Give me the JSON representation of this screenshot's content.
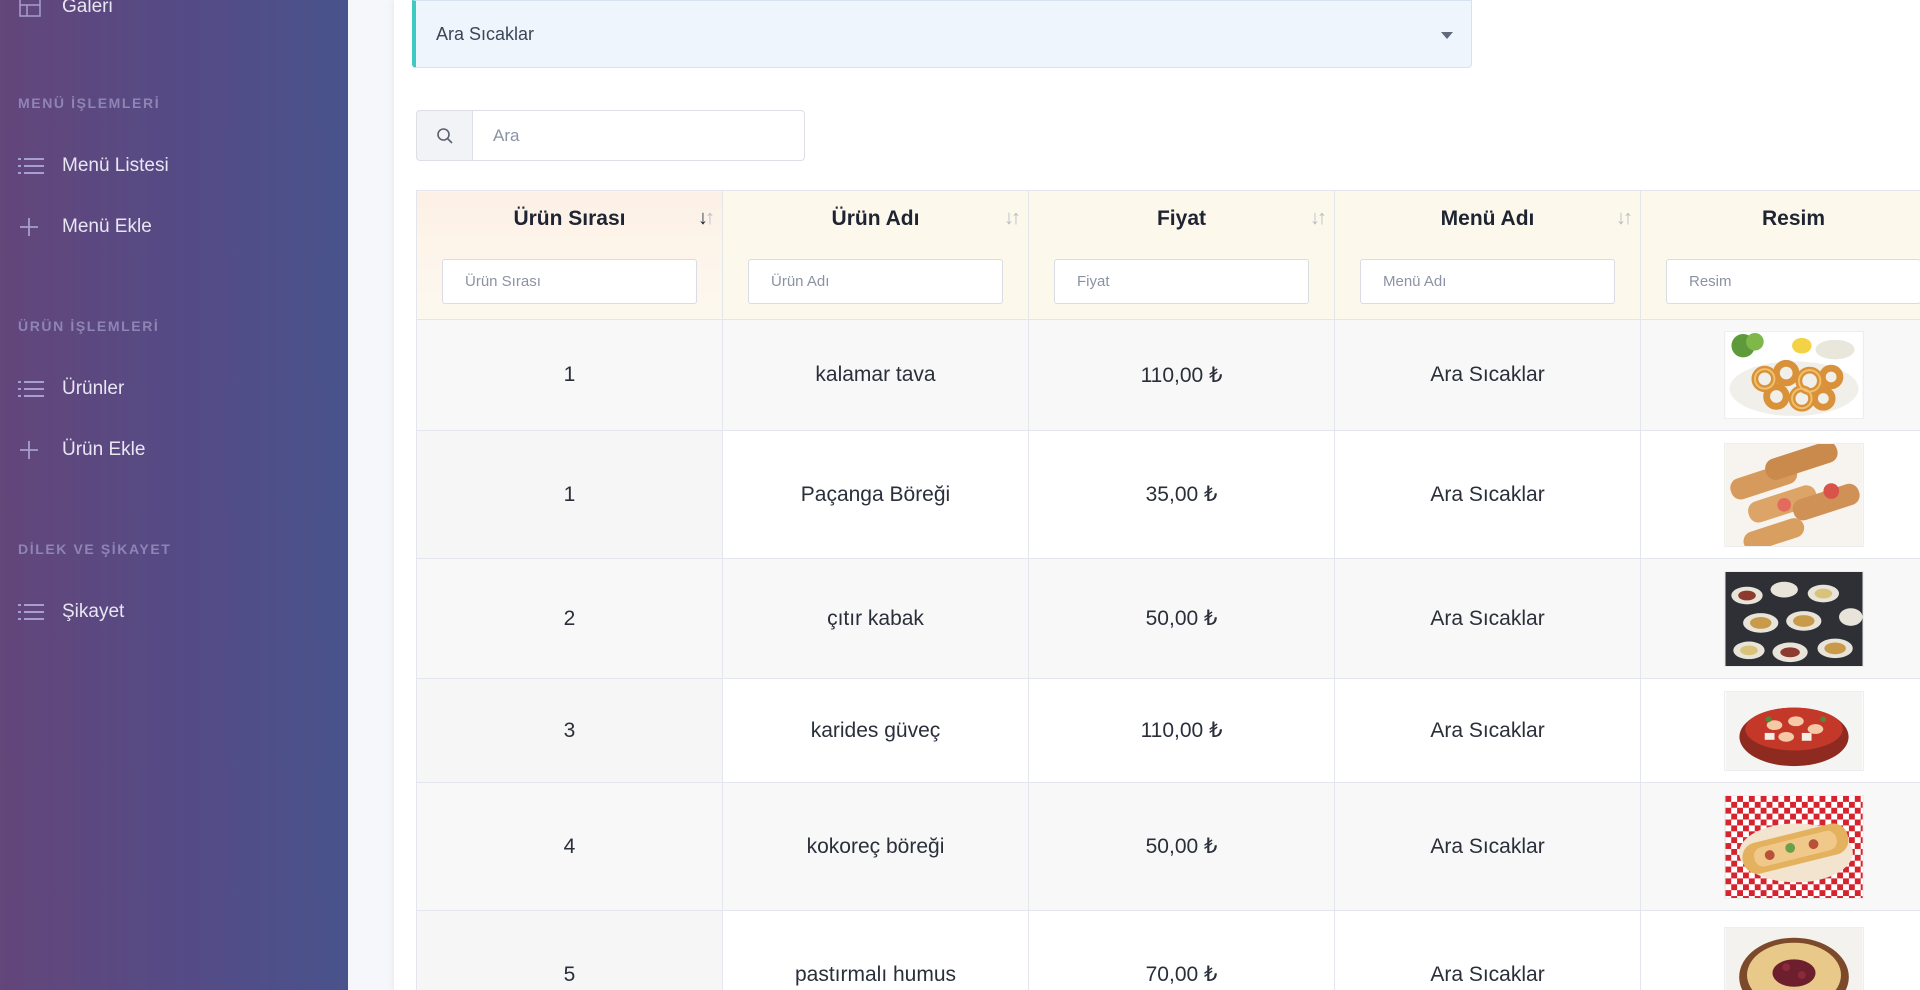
{
  "sidebar": {
    "gallery_label": "Galeri",
    "sections": {
      "menu_ops": "MENÜ İŞLEMLERİ",
      "product_ops": "ÜRÜN İŞLEMLERİ",
      "complaints": "DİLEK VE ŞİKAYET"
    },
    "items": {
      "menu_list": "Menü Listesi",
      "menu_add": "Menü Ekle",
      "products": "Ürünler",
      "product_add": "Ürün Ekle",
      "complaint": "Şikayet"
    }
  },
  "menu_select": {
    "value": "Ara Sıcaklar"
  },
  "search": {
    "placeholder": "Ara"
  },
  "table": {
    "columns": [
      {
        "label": "Ürün Sırası",
        "filter_placeholder": "Ürün Sırası"
      },
      {
        "label": "Ürün Adı",
        "filter_placeholder": "Ürün Adı"
      },
      {
        "label": "Fiyat",
        "filter_placeholder": "Fiyat"
      },
      {
        "label": "Menü Adı",
        "filter_placeholder": "Menü Adı"
      },
      {
        "label": "Resim",
        "filter_placeholder": "Resim"
      }
    ],
    "rows": [
      {
        "order": "1",
        "name": "kalamar tava",
        "price": "110,00 ₺",
        "menu": "Ara Sıcaklar",
        "image": "fried-calamari"
      },
      {
        "order": "1",
        "name": "Paçanga Böreği",
        "price": "35,00 ₺",
        "menu": "Ara Sıcaklar",
        "image": "pacanga-borek"
      },
      {
        "order": "2",
        "name": "çıtır kabak",
        "price": "50,00 ₺",
        "menu": "Ara Sıcaklar",
        "image": "mezze-table"
      },
      {
        "order": "3",
        "name": "karides güveç",
        "price": "110,00 ₺",
        "menu": "Ara Sıcaklar",
        "image": "shrimp-casserole"
      },
      {
        "order": "4",
        "name": "kokoreç böreği",
        "price": "50,00 ₺",
        "menu": "Ara Sıcaklar",
        "image": "wrap-on-checkered-cloth"
      },
      {
        "order": "5",
        "name": "pastırmalı humus",
        "price": "70,00 ₺",
        "menu": "Ara Sıcaklar",
        "image": "hummus-bowl"
      }
    ]
  },
  "colors": {
    "sidebar_start": "#63467a",
    "sidebar_end": "#49538c",
    "select_accent": "#3ec9c2",
    "header_bg": "#fdf8ec"
  }
}
